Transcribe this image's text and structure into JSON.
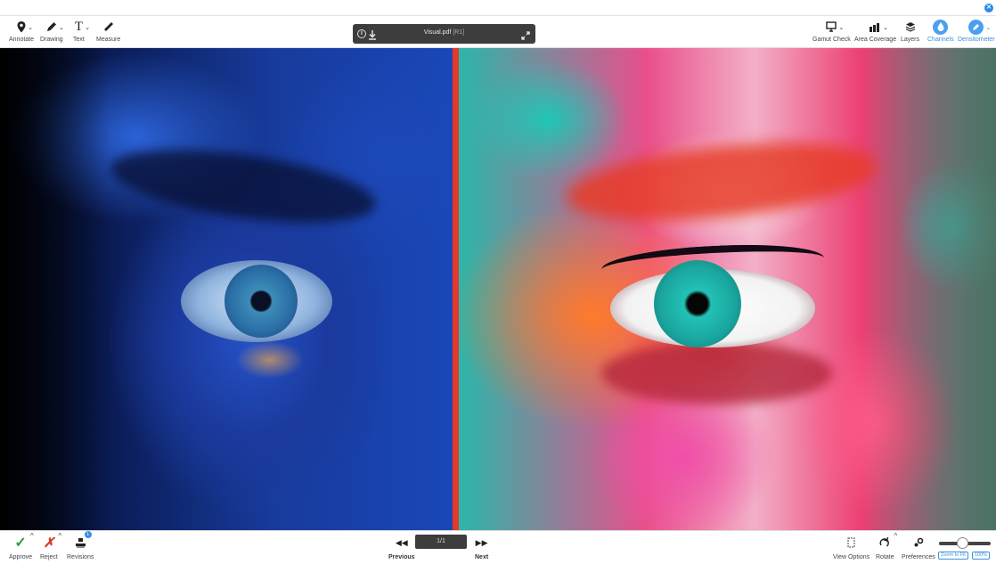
{
  "toolbar": {
    "left_tools": [
      {
        "label": "Annotate",
        "icon": "pin-icon"
      },
      {
        "label": "Drawing",
        "icon": "pencil-icon"
      },
      {
        "label": "Text",
        "icon": "text-icon"
      },
      {
        "label": "Measure",
        "icon": "ruler-icon"
      }
    ],
    "file": {
      "name": "Visual.pdf",
      "revision": "[R1]"
    },
    "right_tools": [
      {
        "label": "Gamut Check",
        "icon": "gamut-icon"
      },
      {
        "label": "Area Coverage",
        "icon": "area-coverage-icon"
      },
      {
        "label": "Layers",
        "icon": "layers-icon"
      },
      {
        "label": "Channels",
        "icon": "drop-icon"
      },
      {
        "label": "Densitometer",
        "icon": "densitometer-icon"
      }
    ]
  },
  "viewer": {
    "divider_color": "#e5372a"
  },
  "bottom": {
    "approve_label": "Approve",
    "reject_label": "Reject",
    "revisions_label": "Revisions",
    "revisions_badge": "1",
    "page_indicator": "1/1",
    "previous_label": "Previous",
    "next_label": "Next",
    "view_options_label": "View Options",
    "rotate_label": "Rotate",
    "preferences_label": "Preferences",
    "zoom_fit_label": "Zoom to Fit",
    "zoom_percent_label": "100%",
    "zoom_level": 0.45
  },
  "colors": {
    "accent": "#3d8fe0",
    "approve": "#2e9e3e",
    "reject": "#d93a2b"
  }
}
